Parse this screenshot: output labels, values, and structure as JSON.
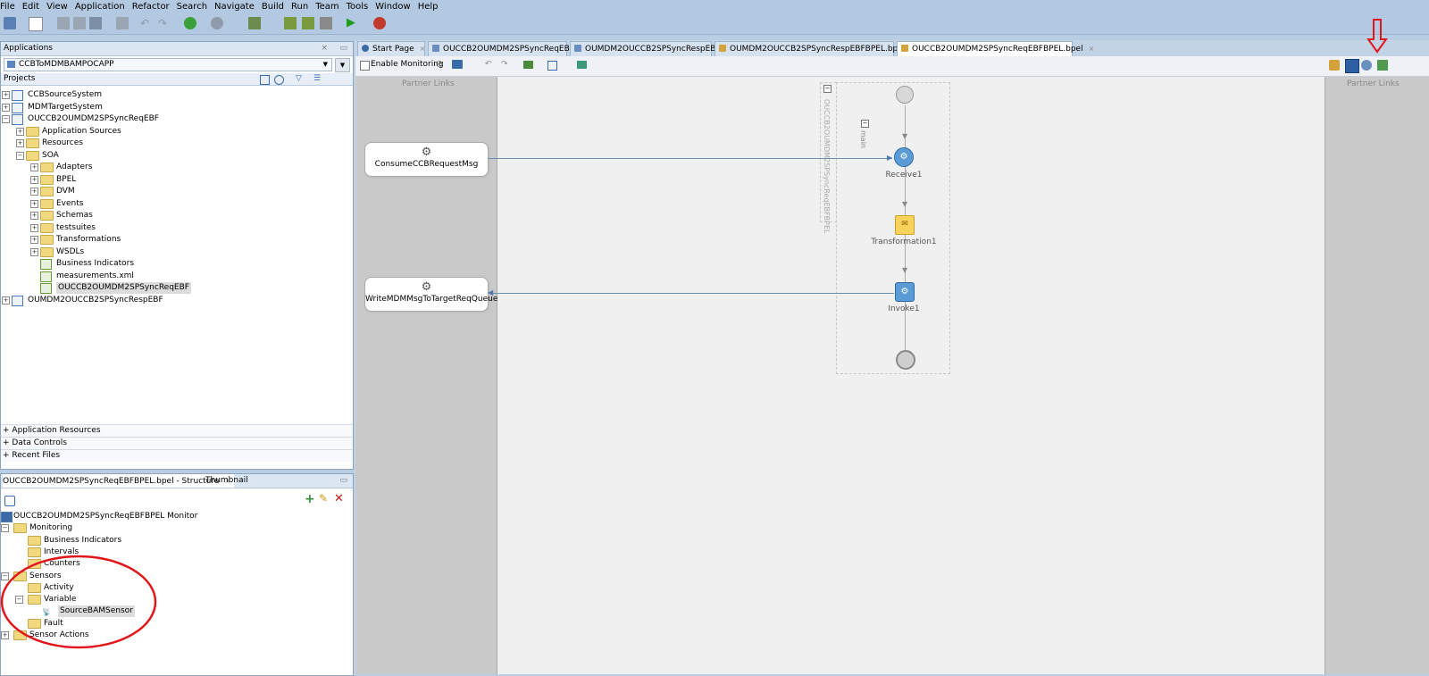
{
  "menu": [
    "File",
    "Edit",
    "View",
    "Application",
    "Refactor",
    "Search",
    "Navigate",
    "Build",
    "Run",
    "Team",
    "Tools",
    "Window",
    "Help"
  ],
  "applications_panel": {
    "title": "Applications",
    "app_selector": "CCBToMDMBAMPOCAPP",
    "projects_label": "Projects",
    "tree": [
      {
        "label": "CCBSourceSystem",
        "level": 0,
        "type": "project"
      },
      {
        "label": "MDMTargetSystem",
        "level": 0,
        "type": "project"
      },
      {
        "label": "OUCCB2OUMDM2SPSyncReqEBF",
        "level": 0,
        "type": "project"
      },
      {
        "label": "Application Sources",
        "level": 1,
        "type": "folder"
      },
      {
        "label": "Resources",
        "level": 1,
        "type": "folder"
      },
      {
        "label": "SOA",
        "level": 1,
        "type": "folder"
      },
      {
        "label": "Adapters",
        "level": 2,
        "type": "folder"
      },
      {
        "label": "BPEL",
        "level": 2,
        "type": "folder"
      },
      {
        "label": "DVM",
        "level": 2,
        "type": "folder"
      },
      {
        "label": "Events",
        "level": 2,
        "type": "folder"
      },
      {
        "label": "Schemas",
        "level": 2,
        "type": "folder"
      },
      {
        "label": "testsuites",
        "level": 2,
        "type": "folder"
      },
      {
        "label": "Transformations",
        "level": 2,
        "type": "folder"
      },
      {
        "label": "WSDLs",
        "level": 2,
        "type": "folder"
      },
      {
        "label": "Business Indicators",
        "level": 2,
        "type": "file"
      },
      {
        "label": "measurements.xml",
        "level": 2,
        "type": "file"
      },
      {
        "label": "OUCCB2OUMDM2SPSyncReqEBF",
        "level": 2,
        "type": "file"
      },
      {
        "label": "OUMDM2OUCCB2SPSyncRespEBF",
        "level": 0,
        "type": "project"
      }
    ],
    "sections": [
      "Application Resources",
      "Data Controls",
      "Recent Files"
    ]
  },
  "structure_panel": {
    "tab_label": "OUCCB2OUMDM2SPSyncReqEBFBPEL.bpel - Structure",
    "thumbnail_tab": "Thumbnail",
    "tree": [
      {
        "label": "OUCCB2OUMDM2SPSyncReqEBFBPEL Monitor",
        "level": 0
      },
      {
        "label": "Monitoring",
        "level": 0
      },
      {
        "label": "Business Indicators",
        "level": 1
      },
      {
        "label": "Intervals",
        "level": 1
      },
      {
        "label": "Counters",
        "level": 1
      },
      {
        "label": "Sensors",
        "level": 0
      },
      {
        "label": "Activity",
        "level": 1
      },
      {
        "label": "Variable",
        "level": 1
      },
      {
        "label": "SourceBAMSensor",
        "level": 2
      },
      {
        "label": "Fault",
        "level": 1
      },
      {
        "label": "Sensor Actions",
        "level": 0
      }
    ]
  },
  "editor_tabs": [
    {
      "label": "Start Page",
      "active": false
    },
    {
      "label": "OUCCB2OUMDM2SPSyncReqEBF",
      "active": false
    },
    {
      "label": "OUMDM2OUCCB2SPSyncRespEBF",
      "active": false
    },
    {
      "label": "OUMDM2OUCCB2SPSyncRespEBFBPEL.bpel",
      "active": false
    },
    {
      "label": "OUCCB2OUMDM2SPSyncReqEBFBPEL.bpel",
      "active": true
    }
  ],
  "editor_toolbar": {
    "enable_monitoring": "Enable Monitoring"
  },
  "canvas": {
    "left_lane_label": "Partner Links",
    "right_lane_label": "Partner Links",
    "process_name": "OUCCB2OUMDM2SPSyncReqEBFBPEL",
    "scope_label": "main",
    "partner_links": [
      "ConsumeCCBRequestMsg",
      "WriteMDMMsgToTargetReqQueue"
    ],
    "activities": [
      "Receive1",
      "Transformation1",
      "Invoke1"
    ]
  },
  "colors": {
    "annotation_red": "#e0161b",
    "receive_blue": "#5b9bd5",
    "transform_yellow": "#f7d35c"
  }
}
